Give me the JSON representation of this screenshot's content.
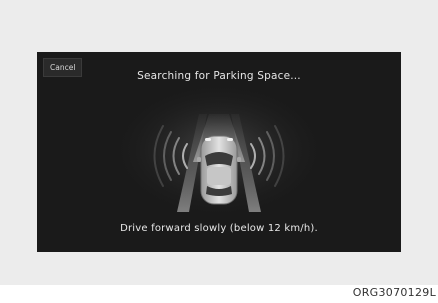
{
  "screen": {
    "cancel_label": "Cancel",
    "title": "Searching for Parking Space...",
    "message": "Drive forward slowly (below 12 km/h)."
  },
  "caption": "ORG3070129L",
  "colors": {
    "screen_background": "#1a1a1a",
    "text": "#e6e6e6",
    "sensor_waves": "#cfcfcf",
    "vehicle_body": "#d4d4d4"
  },
  "icons": {
    "vehicle": "car-top-view-icon",
    "sensor": "ultrasonic-sensor-waves-icon",
    "path": "guidance-path-icon"
  }
}
